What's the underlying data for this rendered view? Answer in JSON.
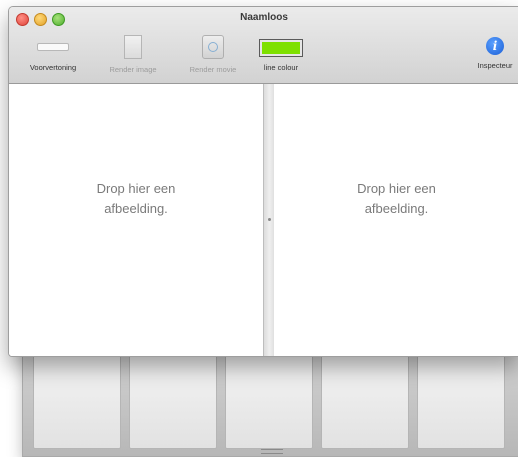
{
  "window": {
    "title": "Naamloos"
  },
  "toolbar": {
    "items": [
      {
        "label": "Voorvertoning",
        "icon": "preview-icon",
        "enabled": true
      },
      {
        "label": "Render image",
        "icon": "render-image-icon",
        "enabled": false
      },
      {
        "label": "Render movie",
        "icon": "render-movie-icon",
        "enabled": false
      },
      {
        "label": "line colour",
        "icon": "color-swatch-icon",
        "enabled": true
      },
      {
        "label": "Inspecteur",
        "icon": "info-icon",
        "enabled": true
      }
    ],
    "line_colour": "#7ee000",
    "info_glyph": "i"
  },
  "panes": {
    "left": {
      "line1": "Drop hier een",
      "line2": "afbeelding."
    },
    "right": {
      "line1": "Drop hier een",
      "line2": "afbeelding."
    }
  }
}
